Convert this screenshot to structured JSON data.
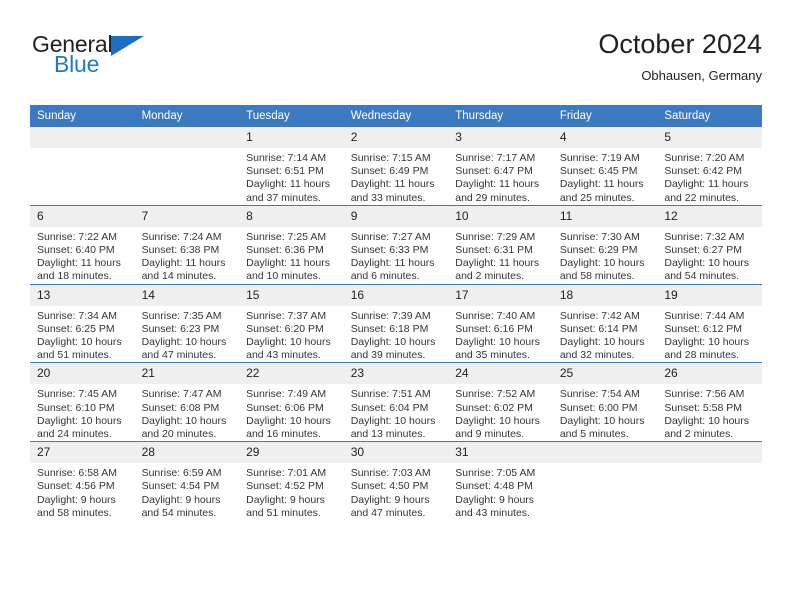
{
  "logo": {
    "word_one": "General",
    "word_two": "Blue",
    "flag_icon": "blue-triangle-flag"
  },
  "header": {
    "title": "October 2024",
    "subtitle": "Obhausen, Germany"
  },
  "colors": {
    "header_blue": "#3b7ac0",
    "logo_blue": "#1f7ac4",
    "daynum_bg": "#efefef",
    "text": "#231f20"
  },
  "weekday_headers": [
    "Sunday",
    "Monday",
    "Tuesday",
    "Wednesday",
    "Thursday",
    "Friday",
    "Saturday"
  ],
  "weeks": [
    [
      {
        "day": "",
        "sunrise": "",
        "sunset": "",
        "daylight_line1": "",
        "daylight_line2": ""
      },
      {
        "day": "",
        "sunrise": "",
        "sunset": "",
        "daylight_line1": "",
        "daylight_line2": ""
      },
      {
        "day": "1",
        "sunrise": "Sunrise: 7:14 AM",
        "sunset": "Sunset: 6:51 PM",
        "daylight_line1": "Daylight: 11 hours",
        "daylight_line2": "and 37 minutes."
      },
      {
        "day": "2",
        "sunrise": "Sunrise: 7:15 AM",
        "sunset": "Sunset: 6:49 PM",
        "daylight_line1": "Daylight: 11 hours",
        "daylight_line2": "and 33 minutes."
      },
      {
        "day": "3",
        "sunrise": "Sunrise: 7:17 AM",
        "sunset": "Sunset: 6:47 PM",
        "daylight_line1": "Daylight: 11 hours",
        "daylight_line2": "and 29 minutes."
      },
      {
        "day": "4",
        "sunrise": "Sunrise: 7:19 AM",
        "sunset": "Sunset: 6:45 PM",
        "daylight_line1": "Daylight: 11 hours",
        "daylight_line2": "and 25 minutes."
      },
      {
        "day": "5",
        "sunrise": "Sunrise: 7:20 AM",
        "sunset": "Sunset: 6:42 PM",
        "daylight_line1": "Daylight: 11 hours",
        "daylight_line2": "and 22 minutes."
      }
    ],
    [
      {
        "day": "6",
        "sunrise": "Sunrise: 7:22 AM",
        "sunset": "Sunset: 6:40 PM",
        "daylight_line1": "Daylight: 11 hours",
        "daylight_line2": "and 18 minutes."
      },
      {
        "day": "7",
        "sunrise": "Sunrise: 7:24 AM",
        "sunset": "Sunset: 6:38 PM",
        "daylight_line1": "Daylight: 11 hours",
        "daylight_line2": "and 14 minutes."
      },
      {
        "day": "8",
        "sunrise": "Sunrise: 7:25 AM",
        "sunset": "Sunset: 6:36 PM",
        "daylight_line1": "Daylight: 11 hours",
        "daylight_line2": "and 10 minutes."
      },
      {
        "day": "9",
        "sunrise": "Sunrise: 7:27 AM",
        "sunset": "Sunset: 6:33 PM",
        "daylight_line1": "Daylight: 11 hours",
        "daylight_line2": "and 6 minutes."
      },
      {
        "day": "10",
        "sunrise": "Sunrise: 7:29 AM",
        "sunset": "Sunset: 6:31 PM",
        "daylight_line1": "Daylight: 11 hours",
        "daylight_line2": "and 2 minutes."
      },
      {
        "day": "11",
        "sunrise": "Sunrise: 7:30 AM",
        "sunset": "Sunset: 6:29 PM",
        "daylight_line1": "Daylight: 10 hours",
        "daylight_line2": "and 58 minutes."
      },
      {
        "day": "12",
        "sunrise": "Sunrise: 7:32 AM",
        "sunset": "Sunset: 6:27 PM",
        "daylight_line1": "Daylight: 10 hours",
        "daylight_line2": "and 54 minutes."
      }
    ],
    [
      {
        "day": "13",
        "sunrise": "Sunrise: 7:34 AM",
        "sunset": "Sunset: 6:25 PM",
        "daylight_line1": "Daylight: 10 hours",
        "daylight_line2": "and 51 minutes."
      },
      {
        "day": "14",
        "sunrise": "Sunrise: 7:35 AM",
        "sunset": "Sunset: 6:23 PM",
        "daylight_line1": "Daylight: 10 hours",
        "daylight_line2": "and 47 minutes."
      },
      {
        "day": "15",
        "sunrise": "Sunrise: 7:37 AM",
        "sunset": "Sunset: 6:20 PM",
        "daylight_line1": "Daylight: 10 hours",
        "daylight_line2": "and 43 minutes."
      },
      {
        "day": "16",
        "sunrise": "Sunrise: 7:39 AM",
        "sunset": "Sunset: 6:18 PM",
        "daylight_line1": "Daylight: 10 hours",
        "daylight_line2": "and 39 minutes."
      },
      {
        "day": "17",
        "sunrise": "Sunrise: 7:40 AM",
        "sunset": "Sunset: 6:16 PM",
        "daylight_line1": "Daylight: 10 hours",
        "daylight_line2": "and 35 minutes."
      },
      {
        "day": "18",
        "sunrise": "Sunrise: 7:42 AM",
        "sunset": "Sunset: 6:14 PM",
        "daylight_line1": "Daylight: 10 hours",
        "daylight_line2": "and 32 minutes."
      },
      {
        "day": "19",
        "sunrise": "Sunrise: 7:44 AM",
        "sunset": "Sunset: 6:12 PM",
        "daylight_line1": "Daylight: 10 hours",
        "daylight_line2": "and 28 minutes."
      }
    ],
    [
      {
        "day": "20",
        "sunrise": "Sunrise: 7:45 AM",
        "sunset": "Sunset: 6:10 PM",
        "daylight_line1": "Daylight: 10 hours",
        "daylight_line2": "and 24 minutes."
      },
      {
        "day": "21",
        "sunrise": "Sunrise: 7:47 AM",
        "sunset": "Sunset: 6:08 PM",
        "daylight_line1": "Daylight: 10 hours",
        "daylight_line2": "and 20 minutes."
      },
      {
        "day": "22",
        "sunrise": "Sunrise: 7:49 AM",
        "sunset": "Sunset: 6:06 PM",
        "daylight_line1": "Daylight: 10 hours",
        "daylight_line2": "and 16 minutes."
      },
      {
        "day": "23",
        "sunrise": "Sunrise: 7:51 AM",
        "sunset": "Sunset: 6:04 PM",
        "daylight_line1": "Daylight: 10 hours",
        "daylight_line2": "and 13 minutes."
      },
      {
        "day": "24",
        "sunrise": "Sunrise: 7:52 AM",
        "sunset": "Sunset: 6:02 PM",
        "daylight_line1": "Daylight: 10 hours",
        "daylight_line2": "and 9 minutes."
      },
      {
        "day": "25",
        "sunrise": "Sunrise: 7:54 AM",
        "sunset": "Sunset: 6:00 PM",
        "daylight_line1": "Daylight: 10 hours",
        "daylight_line2": "and 5 minutes."
      },
      {
        "day": "26",
        "sunrise": "Sunrise: 7:56 AM",
        "sunset": "Sunset: 5:58 PM",
        "daylight_line1": "Daylight: 10 hours",
        "daylight_line2": "and 2 minutes."
      }
    ],
    [
      {
        "day": "27",
        "sunrise": "Sunrise: 6:58 AM",
        "sunset": "Sunset: 4:56 PM",
        "daylight_line1": "Daylight: 9 hours",
        "daylight_line2": "and 58 minutes."
      },
      {
        "day": "28",
        "sunrise": "Sunrise: 6:59 AM",
        "sunset": "Sunset: 4:54 PM",
        "daylight_line1": "Daylight: 9 hours",
        "daylight_line2": "and 54 minutes."
      },
      {
        "day": "29",
        "sunrise": "Sunrise: 7:01 AM",
        "sunset": "Sunset: 4:52 PM",
        "daylight_line1": "Daylight: 9 hours",
        "daylight_line2": "and 51 minutes."
      },
      {
        "day": "30",
        "sunrise": "Sunrise: 7:03 AM",
        "sunset": "Sunset: 4:50 PM",
        "daylight_line1": "Daylight: 9 hours",
        "daylight_line2": "and 47 minutes."
      },
      {
        "day": "31",
        "sunrise": "Sunrise: 7:05 AM",
        "sunset": "Sunset: 4:48 PM",
        "daylight_line1": "Daylight: 9 hours",
        "daylight_line2": "and 43 minutes."
      },
      {
        "day": "",
        "sunrise": "",
        "sunset": "",
        "daylight_line1": "",
        "daylight_line2": ""
      },
      {
        "day": "",
        "sunrise": "",
        "sunset": "",
        "daylight_line1": "",
        "daylight_line2": ""
      }
    ]
  ]
}
